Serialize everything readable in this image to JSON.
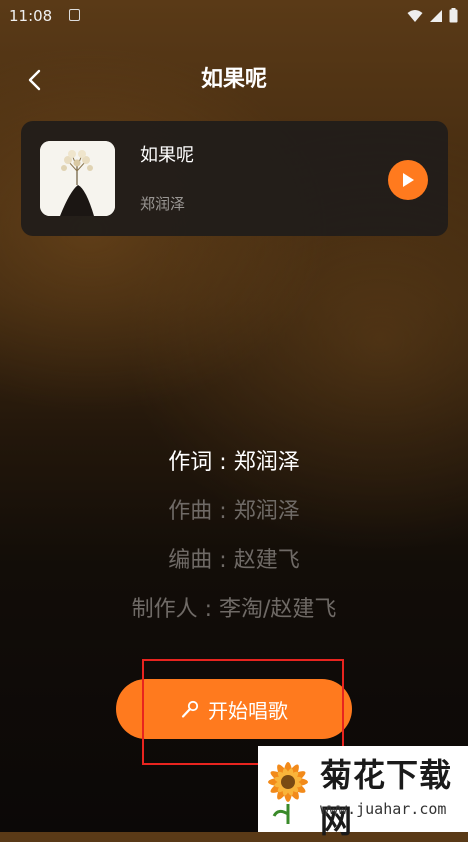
{
  "status_bar": {
    "time": "11:08"
  },
  "header": {
    "title": "如果呢"
  },
  "song": {
    "title": "如果呢",
    "artist": "郑润泽",
    "cover_text": "如果呢"
  },
  "credits": {
    "lyricist": "作词 : 郑润泽",
    "composer": "作曲 : 郑润泽",
    "arranger": "编曲 : 赵建飞",
    "producer": "制作人 : 李淘/赵建飞"
  },
  "actions": {
    "sing_label": "开始唱歌"
  },
  "watermark": {
    "brand": "菊花下载网",
    "url": "www.juahar.com"
  },
  "colors": {
    "accent": "#ff7a1e",
    "highlight": "#e8241f"
  }
}
